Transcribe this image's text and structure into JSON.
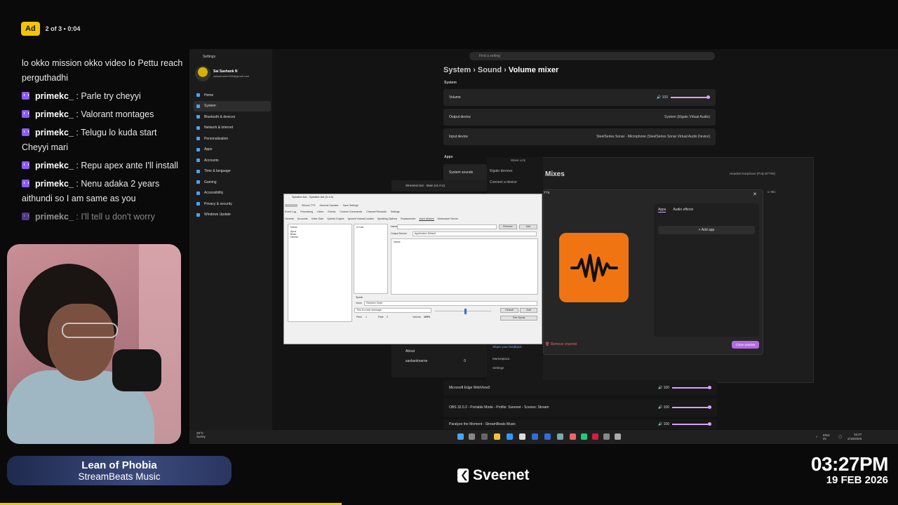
{
  "ad": {
    "badge": "Ad",
    "info": "2 of 3 • 0:04"
  },
  "chat": [
    {
      "user": "",
      "text": "lo okko mission okko video lo Pettu reach perguthadhi"
    },
    {
      "user": "primekc_",
      "text": " : Parle try cheyyi"
    },
    {
      "user": "primekc_",
      "text": " : Valorant montages"
    },
    {
      "user": "primekc_",
      "text": " : Telugu lo kuda start Cheyyi mari"
    },
    {
      "user": "primekc_",
      "text": " : Repu apex ante I'll install"
    },
    {
      "user": "primekc_",
      "text": " : Nenu adaka 2 years aithundi so I am same as you"
    },
    {
      "user": "primekc_",
      "text": " : I'll tell u don't worry"
    }
  ],
  "settings": {
    "title": "Settings",
    "account_name": "Sai Sashank N",
    "account_email": "saisashank1339@gmail.com",
    "nav": [
      "Home",
      "System",
      "Bluetooth & devices",
      "Network & internet",
      "Personalization",
      "Apps",
      "Accounts",
      "Time & language",
      "Gaming",
      "Accessibility",
      "Privacy & security",
      "Windows Update"
    ],
    "search_placeholder": "Find a setting",
    "crumb1": "System",
    "crumb2": "Sound",
    "crumb3": "Volume mixer",
    "section_system": "System",
    "volume_label": "Volume",
    "volume_value": "100",
    "output_label": "Output device",
    "output_value": "System (Elgato Virtual Audio)",
    "input_label": "Input device",
    "input_value": "SteelSeries Sonar - Microphone (SteelSeries Sonar Virtual Audio Device)",
    "section_apps": "Apps",
    "system_sounds": "System sounds",
    "mixer_rows": [
      {
        "name": "Microsoft Edge WebView2",
        "value": "100"
      },
      {
        "name": "OBS 32.0.2 - Portable Mode - Profile: Sveenet - Scenes: Stream",
        "value": "100"
      },
      {
        "name": "Paralyze the Moment - StreamBeats Music",
        "value": "100"
      }
    ]
  },
  "wavelink": {
    "title": "Wave Link",
    "side": [
      "Elgato devices",
      "Connect a device"
    ],
    "side_bottom": [
      "Beta Version",
      "Share your feedback",
      "Marketplace",
      "Settings"
    ],
    "mixes": "Mixes",
    "headset": "Headset Earphone (Poly BT700)",
    "mix_label": "ic Mix",
    "dialog_title": "TTS",
    "tab_apps": "Apps",
    "tab_effects": "Audio effects",
    "add_app": "Add app",
    "remove_channel": "Remove channel",
    "close_window": "Close window"
  },
  "streamerbot": {
    "title": "Streamer.bot - Main (v1.0.4)",
    "side": [
      "Settings",
      "About"
    ],
    "user": "sashanknarne",
    "user_count": "0"
  },
  "speaker": {
    "title": "Speaker.bot - Speaker.bot (0.1.6)",
    "menu": [
      "Silence TTS",
      "General Speaker",
      "Save Settings"
    ],
    "tabs_top": [
      "Event Log",
      "Processing",
      "Users",
      "Events",
      "Custom Commands",
      "Channel Rewards",
      "Settings"
    ],
    "tabs_bottom": [
      "General",
      "Accounts",
      "Voice Gate",
      "Speech Engine",
      "Ignored Voices/Locales",
      "Speaking Options",
      "Replacement",
      "Voice Aliases",
      "Websocket Server"
    ],
    "col_name": "Name",
    "col_inuse": "In Use",
    "col_name2": "Name",
    "list": [
      "Apus",
      "Brian",
      "Dinesh"
    ],
    "output_device_label": "Output Device",
    "output_device_value": "Application Default",
    "btn_remove": "Remove",
    "btn_add": "Add",
    "speak_label": "Speak",
    "voice_label": "Voice",
    "voice_value": "Random Voice",
    "message_value": "This is a test message",
    "btn_default": "Default",
    "btn_add2": "Add",
    "pitch_label": "Pitch",
    "pitch_value": "1",
    "rate_label": "Rate",
    "rate_value": "0",
    "volume_label": "Volume",
    "volume_value": "100%",
    "btn_test": "Test Speak"
  },
  "taskbar": {
    "weather_temp": "29°C",
    "weather_desc": "Sunny",
    "lang": "ENG IN",
    "time": "15:27",
    "date": "2/19/2026"
  },
  "song": {
    "title": "Lean of Phobia",
    "artist": "StreamBeats Music"
  },
  "brand": {
    "name": "Sveenet"
  },
  "clock": {
    "time": "03:27PM",
    "date": "19 FEB 2026"
  },
  "colors": {
    "accent": "#d7a0ff",
    "ad": "#f5c400",
    "tts_icon": "#f07512"
  }
}
